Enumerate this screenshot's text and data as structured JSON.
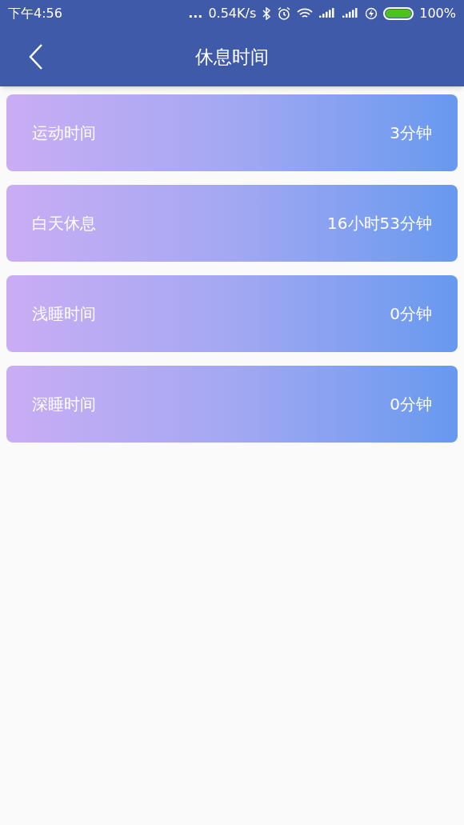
{
  "status_bar": {
    "time": "下午4:56",
    "dots": "...",
    "speed": "0.54K/s",
    "battery": "100%"
  },
  "header": {
    "title": "休息时间"
  },
  "rows": [
    {
      "label": "运动时间",
      "value": "3分钟"
    },
    {
      "label": "白天休息",
      "value": "16小时53分钟"
    },
    {
      "label": "浅睡时间",
      "value": "0分钟"
    },
    {
      "label": "深睡时间",
      "value": "0分钟"
    }
  ]
}
